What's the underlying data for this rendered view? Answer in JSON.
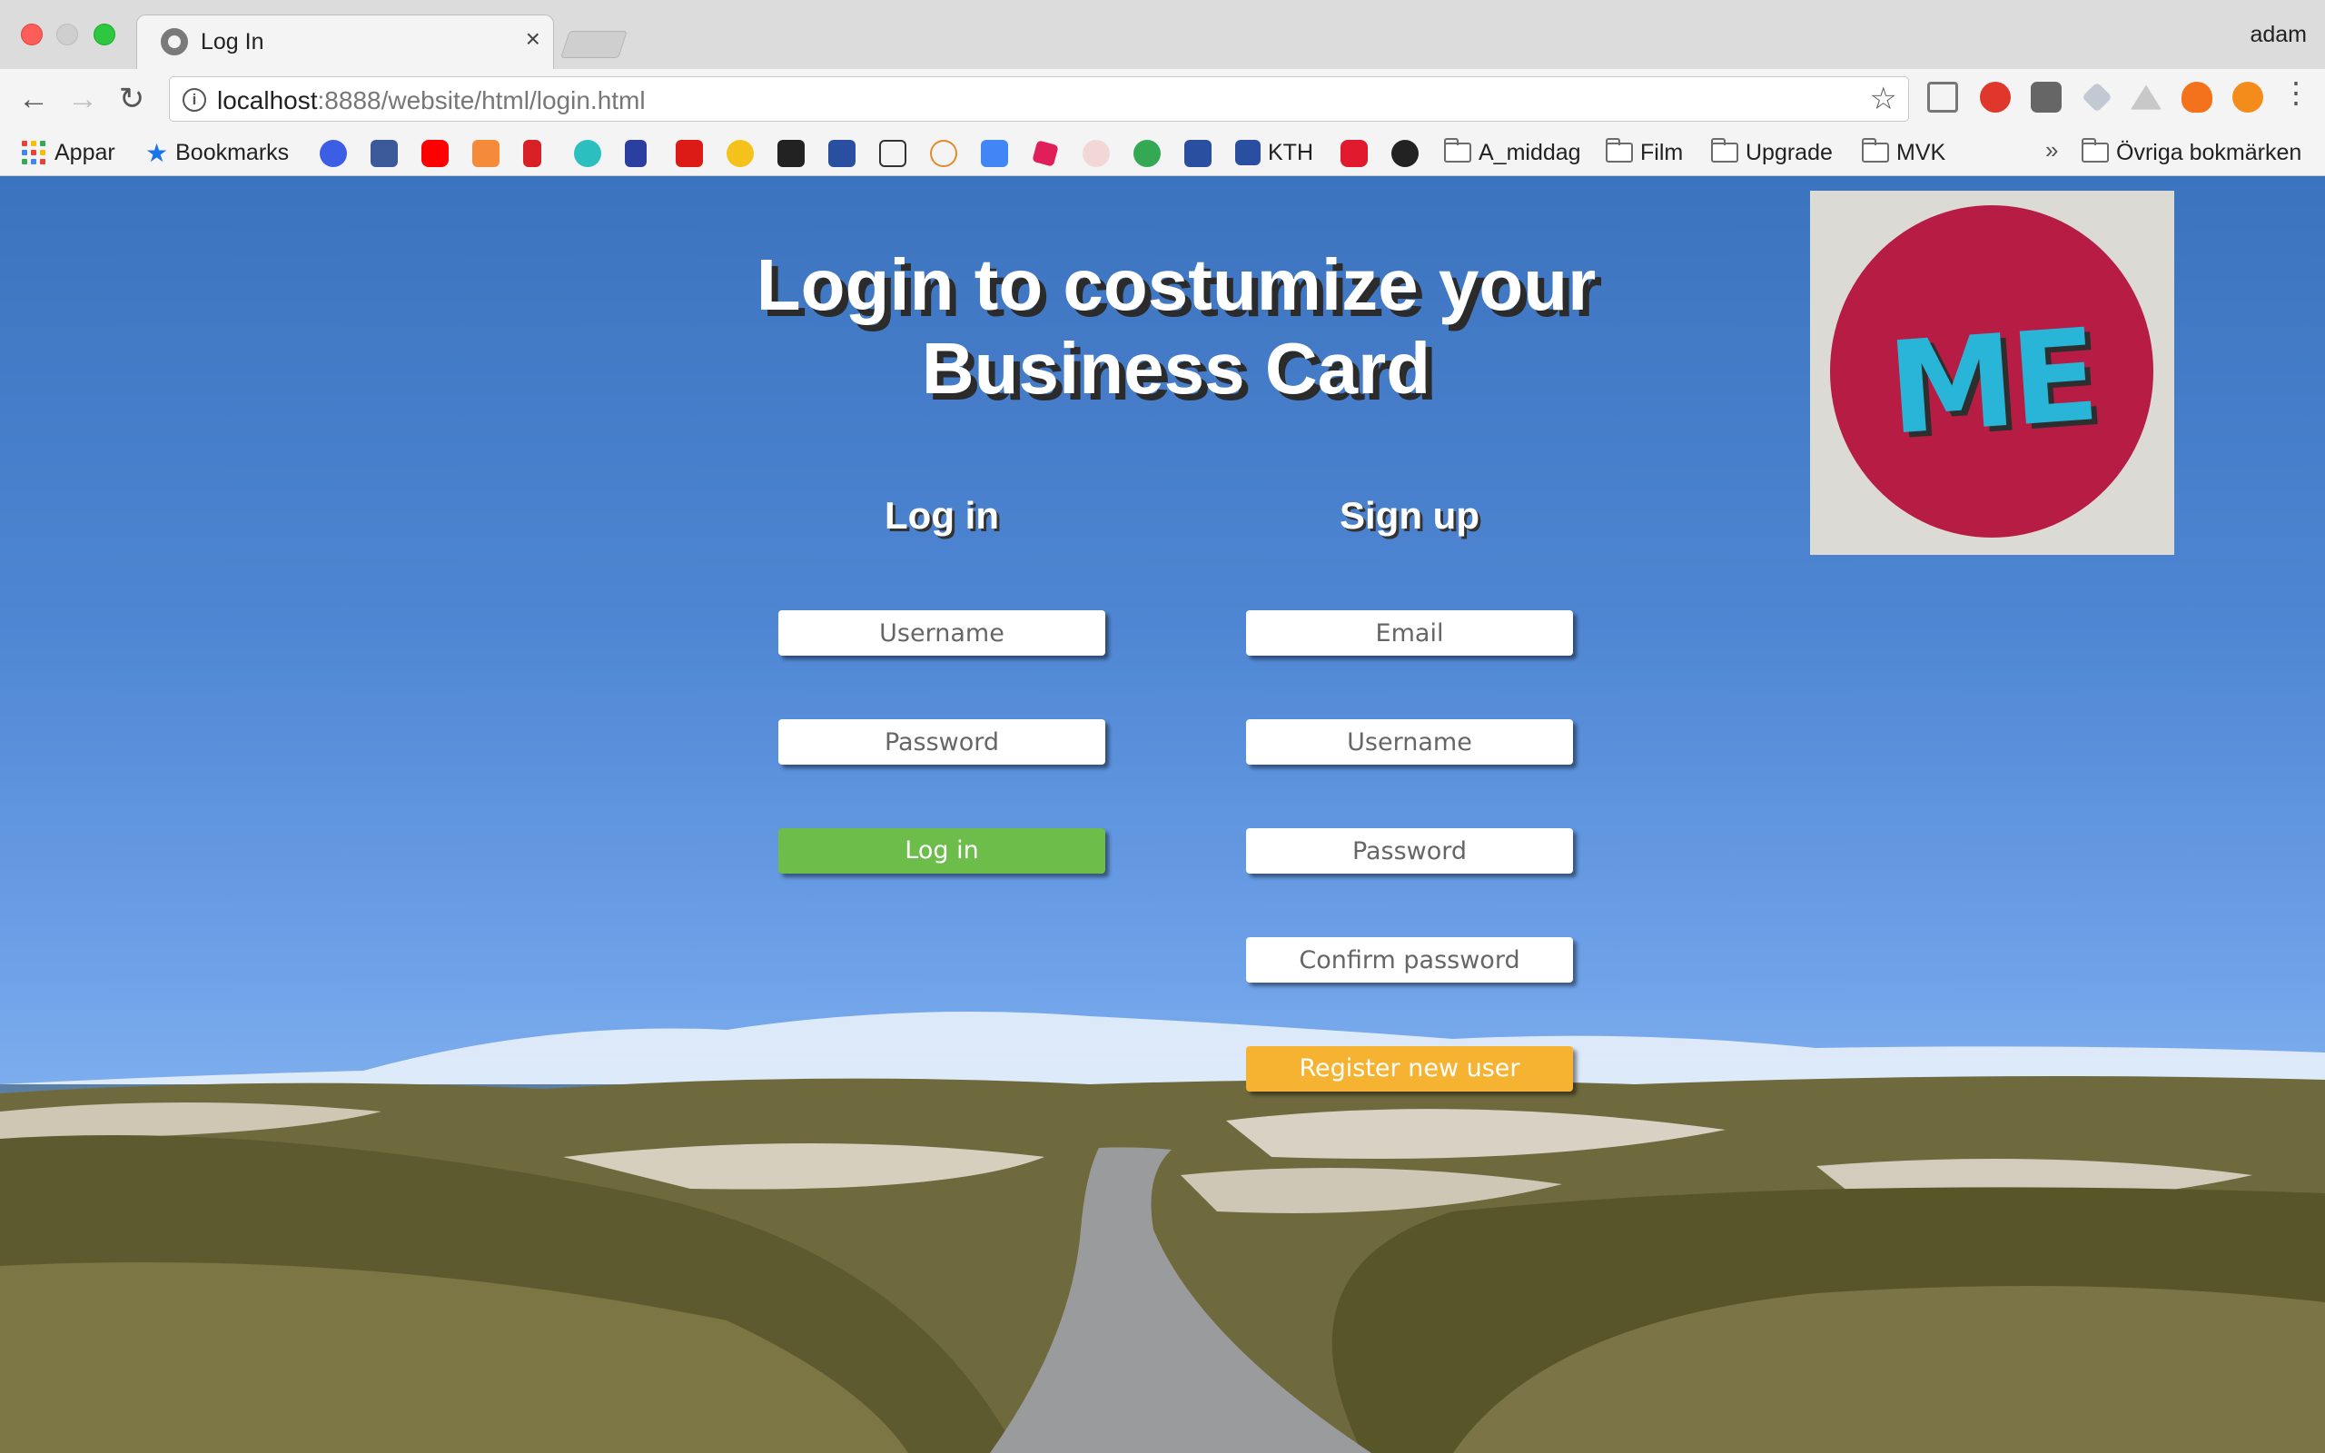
{
  "browser": {
    "tab_title": "Log In",
    "profile_name": "adam",
    "url_host": "localhost",
    "url_rest": ":8888/website/html/login.html",
    "bookmarks": {
      "apps_label": "Appar",
      "bookmarks_label": "Bookmarks",
      "kth_label": "KTH",
      "folders": [
        "A_middag",
        "Film",
        "Upgrade",
        "MVK"
      ],
      "other_label": "Övriga bokmärken",
      "overflow_label": "»"
    }
  },
  "page": {
    "headline": "Login to costumize your Business Card",
    "logo_text": "ME",
    "login": {
      "heading": "Log in",
      "username_placeholder": "Username",
      "password_placeholder": "Password",
      "button_label": "Log in"
    },
    "signup": {
      "heading": "Sign up",
      "email_placeholder": "Email",
      "username_placeholder": "Username",
      "password_placeholder": "Password",
      "confirm_placeholder": "Confirm password",
      "button_label": "Register new user"
    }
  },
  "colors": {
    "login_button": "#6cbd4a",
    "register_button": "#f6b331",
    "logo_circle": "#b71c44",
    "logo_text": "#28b5d8"
  }
}
